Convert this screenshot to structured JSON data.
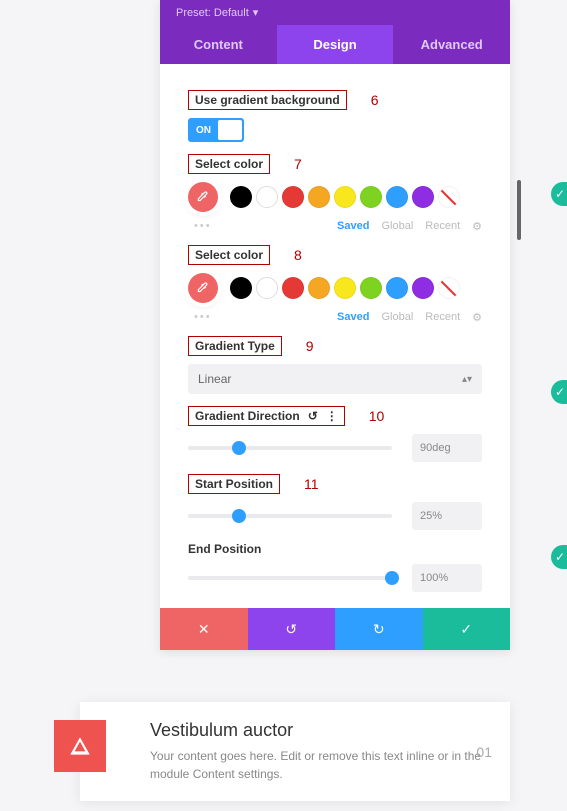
{
  "preset_label": "Preset: Default",
  "tabs": {
    "content": "Content",
    "design": "Design",
    "advanced": "Advanced"
  },
  "section_gradient": {
    "use_label": "Use gradient background",
    "toggle_on": "ON",
    "select_color_1": "Select color",
    "select_color_2": "Select color",
    "swatch_tabs": {
      "saved": "Saved",
      "global": "Global",
      "recent": "Recent"
    },
    "gradient_type_label": "Gradient Type",
    "gradient_type_value": "Linear",
    "direction_label": "Gradient Direction",
    "direction_value": "90deg",
    "start_label": "Start Position",
    "start_value": "25%",
    "end_label": "End Position",
    "end_value": "100%"
  },
  "annotations": {
    "a6": "6",
    "a7": "7",
    "a8": "8",
    "a9": "9",
    "a10": "10",
    "a11": "11"
  },
  "swatches": [
    "#000000",
    "#ffffff",
    "#e53935",
    "#f5a623",
    "#f8e71c",
    "#7ed321",
    "#4a90e2",
    "#8e2de2"
  ],
  "card": {
    "title": "Vestibulum auctor",
    "body": "Your content goes here. Edit or remove this text inline or in the module Content settings.",
    "num": "01"
  }
}
